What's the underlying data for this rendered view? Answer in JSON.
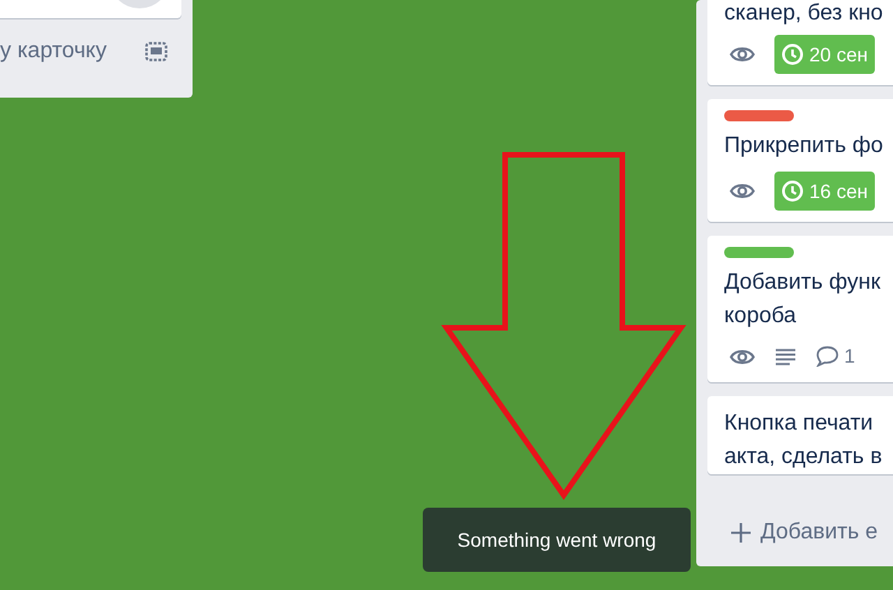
{
  "left_list": {
    "add_card": "у карточку"
  },
  "right_list": {
    "cards": [
      {
        "lines": [
          "сканер, без кно"
        ],
        "badges": [
          {
            "kind": "watch"
          },
          {
            "kind": "due",
            "text": "20 сен"
          }
        ]
      },
      {
        "color": "#eb5a46",
        "lines": [
          "Прикрепить фо"
        ],
        "badges": [
          {
            "kind": "watch"
          },
          {
            "kind": "due",
            "text": "16 сен"
          }
        ]
      },
      {
        "color": "#61bd4f",
        "lines": [
          "Добавить функ",
          "короба"
        ],
        "badges": [
          {
            "kind": "watch"
          },
          {
            "kind": "description"
          },
          {
            "kind": "comments",
            "text": "1"
          }
        ]
      },
      {
        "lines": [
          "Кнопка печати",
          "акта, сделать в"
        ]
      }
    ],
    "add_card": "Добавить е"
  },
  "toast": {
    "message": "Something went wrong"
  }
}
